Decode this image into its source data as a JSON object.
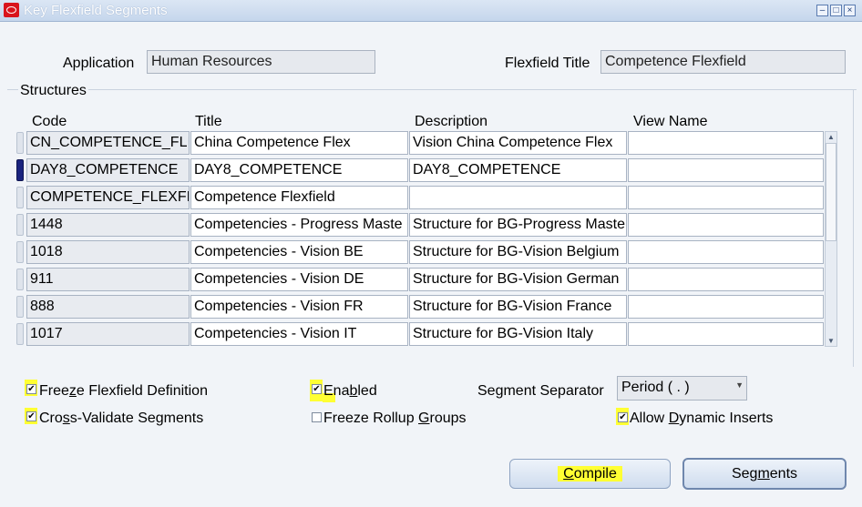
{
  "window": {
    "title": "Key Flexfield Segments"
  },
  "header": {
    "application_label": "Application",
    "application_value": "Human Resources",
    "flexfield_title_label": "Flexfield Title",
    "flexfield_title_value": "Competence Flexfield"
  },
  "structures": {
    "group_label": "Structures",
    "columns": {
      "code": "Code",
      "title": "Title",
      "description": "Description",
      "view_name": "View Name"
    },
    "rows": [
      {
        "code": "CN_COMPETENCE_FLI",
        "title": "China Competence Flex",
        "description": "Vision China Competence Flex",
        "view_name": ""
      },
      {
        "code": "DAY8_COMPETENCE",
        "title": "DAY8_COMPETENCE",
        "description": "DAY8_COMPETENCE",
        "view_name": ""
      },
      {
        "code": "COMPETENCE_FLEXFI",
        "title": "Competence Flexfield",
        "description": "",
        "view_name": ""
      },
      {
        "code": "1448",
        "title": "Competencies - Progress Maste",
        "description": "Structure for BG-Progress Maste",
        "view_name": ""
      },
      {
        "code": "1018",
        "title": "Competencies - Vision BE",
        "description": "Structure for BG-Vision Belgium",
        "view_name": ""
      },
      {
        "code": "911",
        "title": "Competencies - Vision DE",
        "description": "Structure for BG-Vision German",
        "view_name": ""
      },
      {
        "code": "888",
        "title": "Competencies - Vision FR",
        "description": "Structure for BG-Vision France",
        "view_name": ""
      },
      {
        "code": "1017",
        "title": "Competencies - Vision IT",
        "description": "Structure for BG-Vision Italy",
        "view_name": ""
      }
    ]
  },
  "options": {
    "freeze_def": {
      "pre": "Free",
      "mn": "z",
      "post": "e Flexfield Definition",
      "checked": true
    },
    "cross_validate": {
      "pre": "Cro",
      "mn": "s",
      "post": "s-Validate Segments",
      "checked": true
    },
    "enabled": {
      "pre": "Ena",
      "mn": "b",
      "post": "led",
      "checked": true
    },
    "freeze_rollup": {
      "pre": "Freeze Rollup ",
      "mn": "G",
      "post": "roups",
      "checked": false
    },
    "segment_separator_label": "Segment Separator",
    "segment_separator_value": "Period ( . )",
    "allow_dynamic": {
      "pre": "Allow ",
      "mn": "D",
      "post": "ynamic Inserts",
      "checked": true
    }
  },
  "buttons": {
    "compile": {
      "pre": "",
      "mn": "C",
      "post": "ompile"
    },
    "segments": {
      "pre": "Seg",
      "mn": "m",
      "post": "ents"
    }
  },
  "highlight_color": "#ffff33"
}
